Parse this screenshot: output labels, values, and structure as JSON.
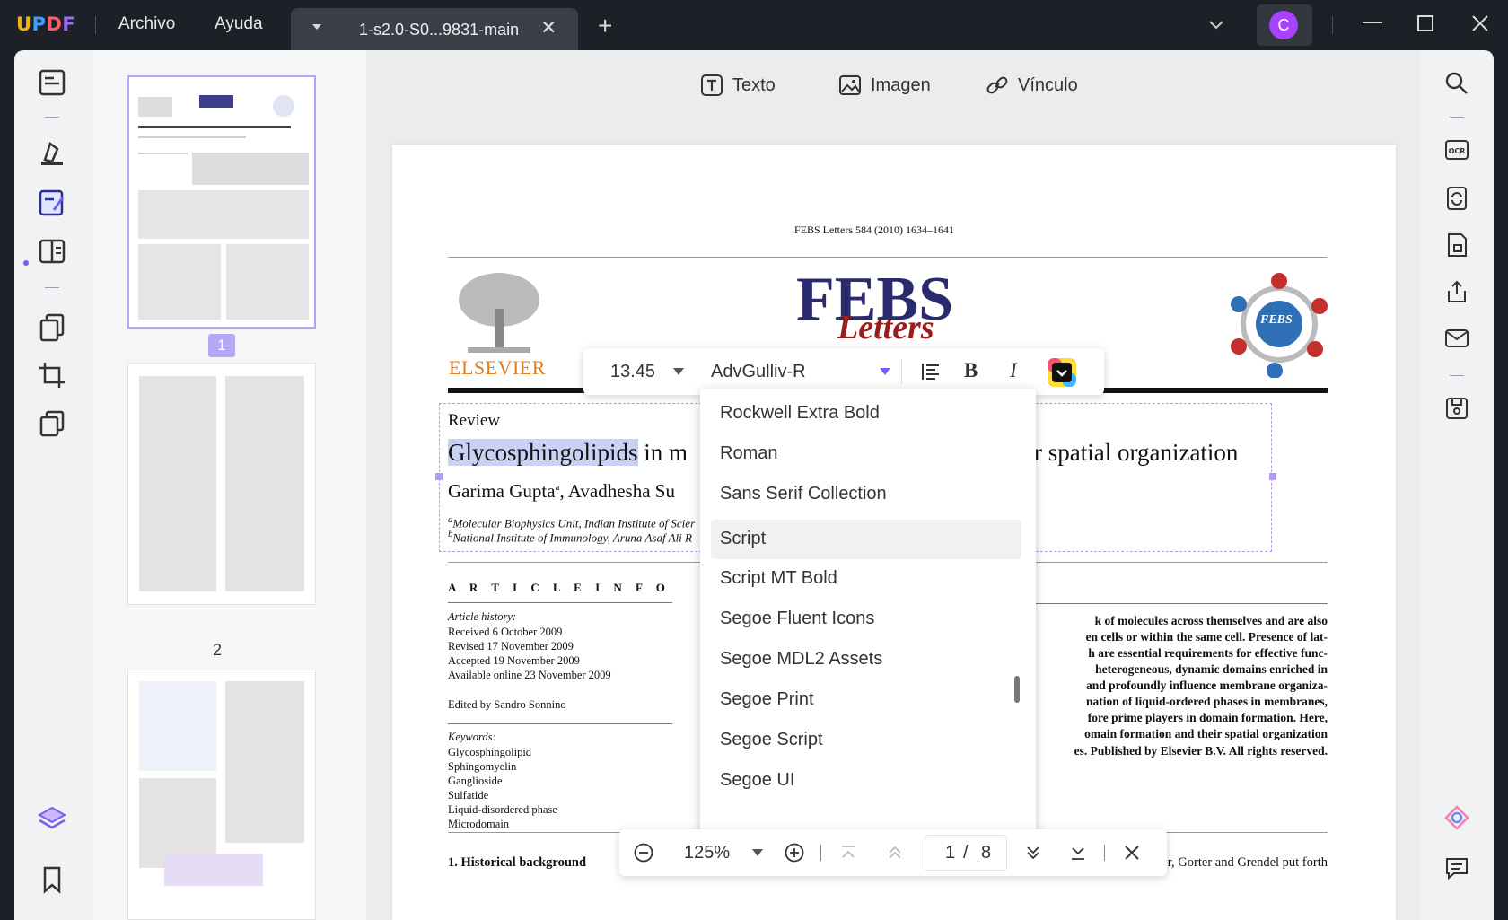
{
  "app": {
    "logo": "UPDF",
    "menu": [
      "Archivo",
      "Ayuda"
    ],
    "tab_title": "1-s2.0-S0...9831-main",
    "avatar_letter": "C",
    "accent_color": "#a742ff"
  },
  "toolbar": {
    "text_label": "Texto",
    "image_label": "Imagen",
    "link_label": "Vínculo"
  },
  "thumbnails": {
    "selected_page": "1",
    "page2_label": "2"
  },
  "document": {
    "journal_line": "FEBS Letters 584 (2010) 1634–1641",
    "publisher": "ELSEVIER",
    "journal_logo_main": "FEBS",
    "journal_logo_sub": "Letters",
    "society_badge": "FEBS",
    "section": "Review",
    "title_highlight": "Glycosphingolipids",
    "title_part": "in m",
    "title_tail": "r spatial organization",
    "authors": "Garima Gupta",
    "authors_sup": "a",
    "authors_tail": ", Avadhesha Su",
    "affil_a": "Molecular Biophysics Unit, Indian Institute of Scier",
    "affil_b": "National Institute of Immunology, Aruna Asaf Ali R",
    "article_info": "A R T I C L E   I N F O",
    "history_label": "Article history:",
    "history": [
      "Received 6 October 2009",
      "Revised 17 November 2009",
      "Accepted 19 November 2009",
      "Available online 23 November 2009"
    ],
    "edited_by": "Edited by Sandro Sonnino",
    "keywords_label": "Keywords:",
    "keywords": [
      "Glycosphingolipid",
      "Sphingomyelin",
      "Ganglioside",
      "Sulfatide",
      "Liquid-disordered phase",
      "Microdomain"
    ],
    "abstract_lines": [
      "k of molecules across themselves and are also",
      "en cells or within the same cell. Presence of lat-",
      "h are essential requirements for effective func-",
      "heterogeneous, dynamic domains enriched in",
      "and profoundly influence membrane organiza-",
      "nation of liquid-ordered phases in membranes,",
      "fore prime players in domain formation. Here,",
      "omain formation and their spatial organization"
    ],
    "copyright": "es. Published by Elsevier B.V. All rights reserved.",
    "section1": "1. Historical background",
    "body_line": "mately 3.3 nm thick; soon after, Gorter and Grendel put forth"
  },
  "format_bar": {
    "font_size": "13.45",
    "font_name": "AdvGulliv-R",
    "bold": "B",
    "italic": "I"
  },
  "font_list": {
    "items": [
      "Rockwell Extra Bold",
      "Roman",
      "Sans Serif Collection",
      "Script",
      "Script MT Bold",
      "Segoe Fluent Icons",
      "Segoe MDL2 Assets",
      "Segoe Print",
      "Segoe Script",
      "Segoe UI"
    ],
    "hovered": "Script"
  },
  "zoom_bar": {
    "zoom": "125%",
    "current_page": "1",
    "page_sep": "/",
    "total_pages": "8"
  }
}
